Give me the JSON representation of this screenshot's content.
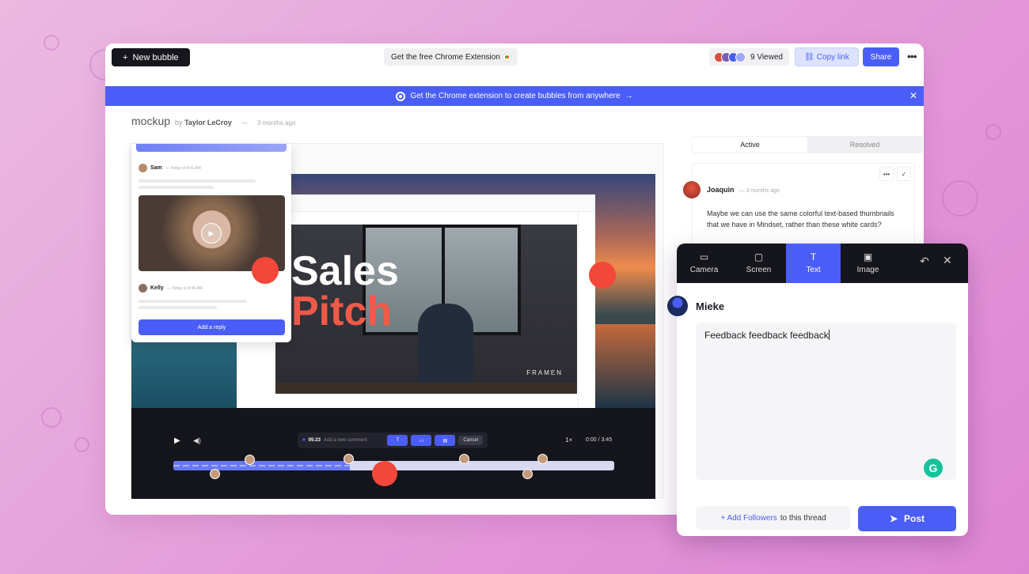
{
  "toolbar": {
    "new_bubble": "New bubble",
    "chrome_ext": "Get the free Chrome Extension",
    "viewed": "9 Viewed",
    "copy_link": "Copy link",
    "share": "Share",
    "more": "•••"
  },
  "banner": {
    "text": "Get the Chrome extension to create bubbles from anywhere",
    "arrow": "→",
    "close": "✕"
  },
  "bubble": {
    "title": "mockup",
    "by": "by",
    "author": "Taylor LeCroy",
    "dash": "—",
    "ago": "3 months ago"
  },
  "video": {
    "slide_title_1": "Sales",
    "slide_title_2": "Pitch",
    "brand": "FRAMEN"
  },
  "mini_comments": {
    "sam": "Sam",
    "sam_time": "— Today at 8:41 AM",
    "kelly": "Kelly",
    "kelly_time": "— Today at 8:46 AM",
    "reply": "Add a reply"
  },
  "player": {
    "comment_time": "05:23",
    "comment_placeholder": "Add a new comment",
    "cancel": "Cancel",
    "speed": "1×",
    "time": "0:00 / 3:45",
    "progress": 0.4
  },
  "tabs": {
    "active": "Active",
    "resolved": "Resolved"
  },
  "thread": {
    "name": "Joaquin",
    "ago": "— 3 months ago",
    "text": "Maybe we can use the same colorful text-based thumbnails that we have in Mindset, rather than these white cards?"
  },
  "composer": {
    "tabs": [
      {
        "label": "Camera",
        "icon": "camera-icon"
      },
      {
        "label": "Screen",
        "icon": "screen-icon"
      },
      {
        "label": "Text",
        "icon": "text-icon"
      },
      {
        "label": "Image",
        "icon": "image-icon"
      }
    ],
    "active_tab": "Text",
    "user": "Mieke",
    "value": "Feedback feedback feedback",
    "add_followers": "+ Add Followers",
    "followers_suffix": "to this thread",
    "post": "Post"
  },
  "colors": {
    "accent": "#4a5ef7",
    "record": "#f2473a",
    "dark": "#15151c"
  }
}
